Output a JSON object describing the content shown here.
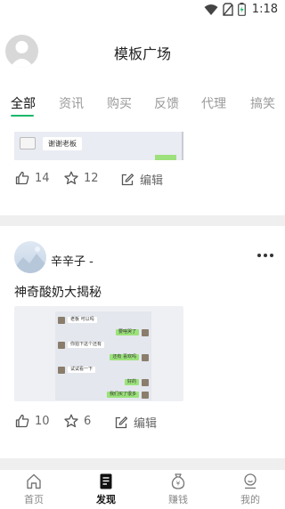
{
  "status_bar": {
    "time": "1:18"
  },
  "header": {
    "title": "模板广场"
  },
  "tabs": [
    {
      "label": "全部",
      "active": true
    },
    {
      "label": "资讯",
      "active": false
    },
    {
      "label": "购买",
      "active": false
    },
    {
      "label": "反馈",
      "active": false
    },
    {
      "label": "代理",
      "active": false
    },
    {
      "label": "搞笑",
      "active": false
    }
  ],
  "accent_color": "#1bb86a",
  "previous_card": {
    "image_text": "谢谢老板",
    "likes": "14",
    "stars": "12",
    "edit_label": "编辑"
  },
  "post": {
    "author": "辛辛子 -",
    "title": "神奇酸奶大揭秘",
    "image_messages": [
      {
        "side": "left",
        "text": "老板 可以吗"
      },
      {
        "side": "right",
        "text": "要啥哭了"
      },
      {
        "side": "left",
        "text": "你拍下这个还有"
      },
      {
        "side": "right",
        "text": "还有 喜欢吗"
      },
      {
        "side": "left",
        "text": "试试看一下"
      },
      {
        "side": "right",
        "text": "好的"
      },
      {
        "side": "right",
        "text": "我们买了很多"
      }
    ],
    "likes": "10",
    "stars": "6",
    "edit_label": "编辑"
  },
  "bottom_nav": [
    {
      "label": "首页",
      "icon": "home-icon",
      "active": false
    },
    {
      "label": "发现",
      "icon": "discover-icon",
      "active": true
    },
    {
      "label": "赚钱",
      "icon": "money-bag-icon",
      "active": false
    },
    {
      "label": "我的",
      "icon": "profile-icon",
      "active": false
    }
  ]
}
